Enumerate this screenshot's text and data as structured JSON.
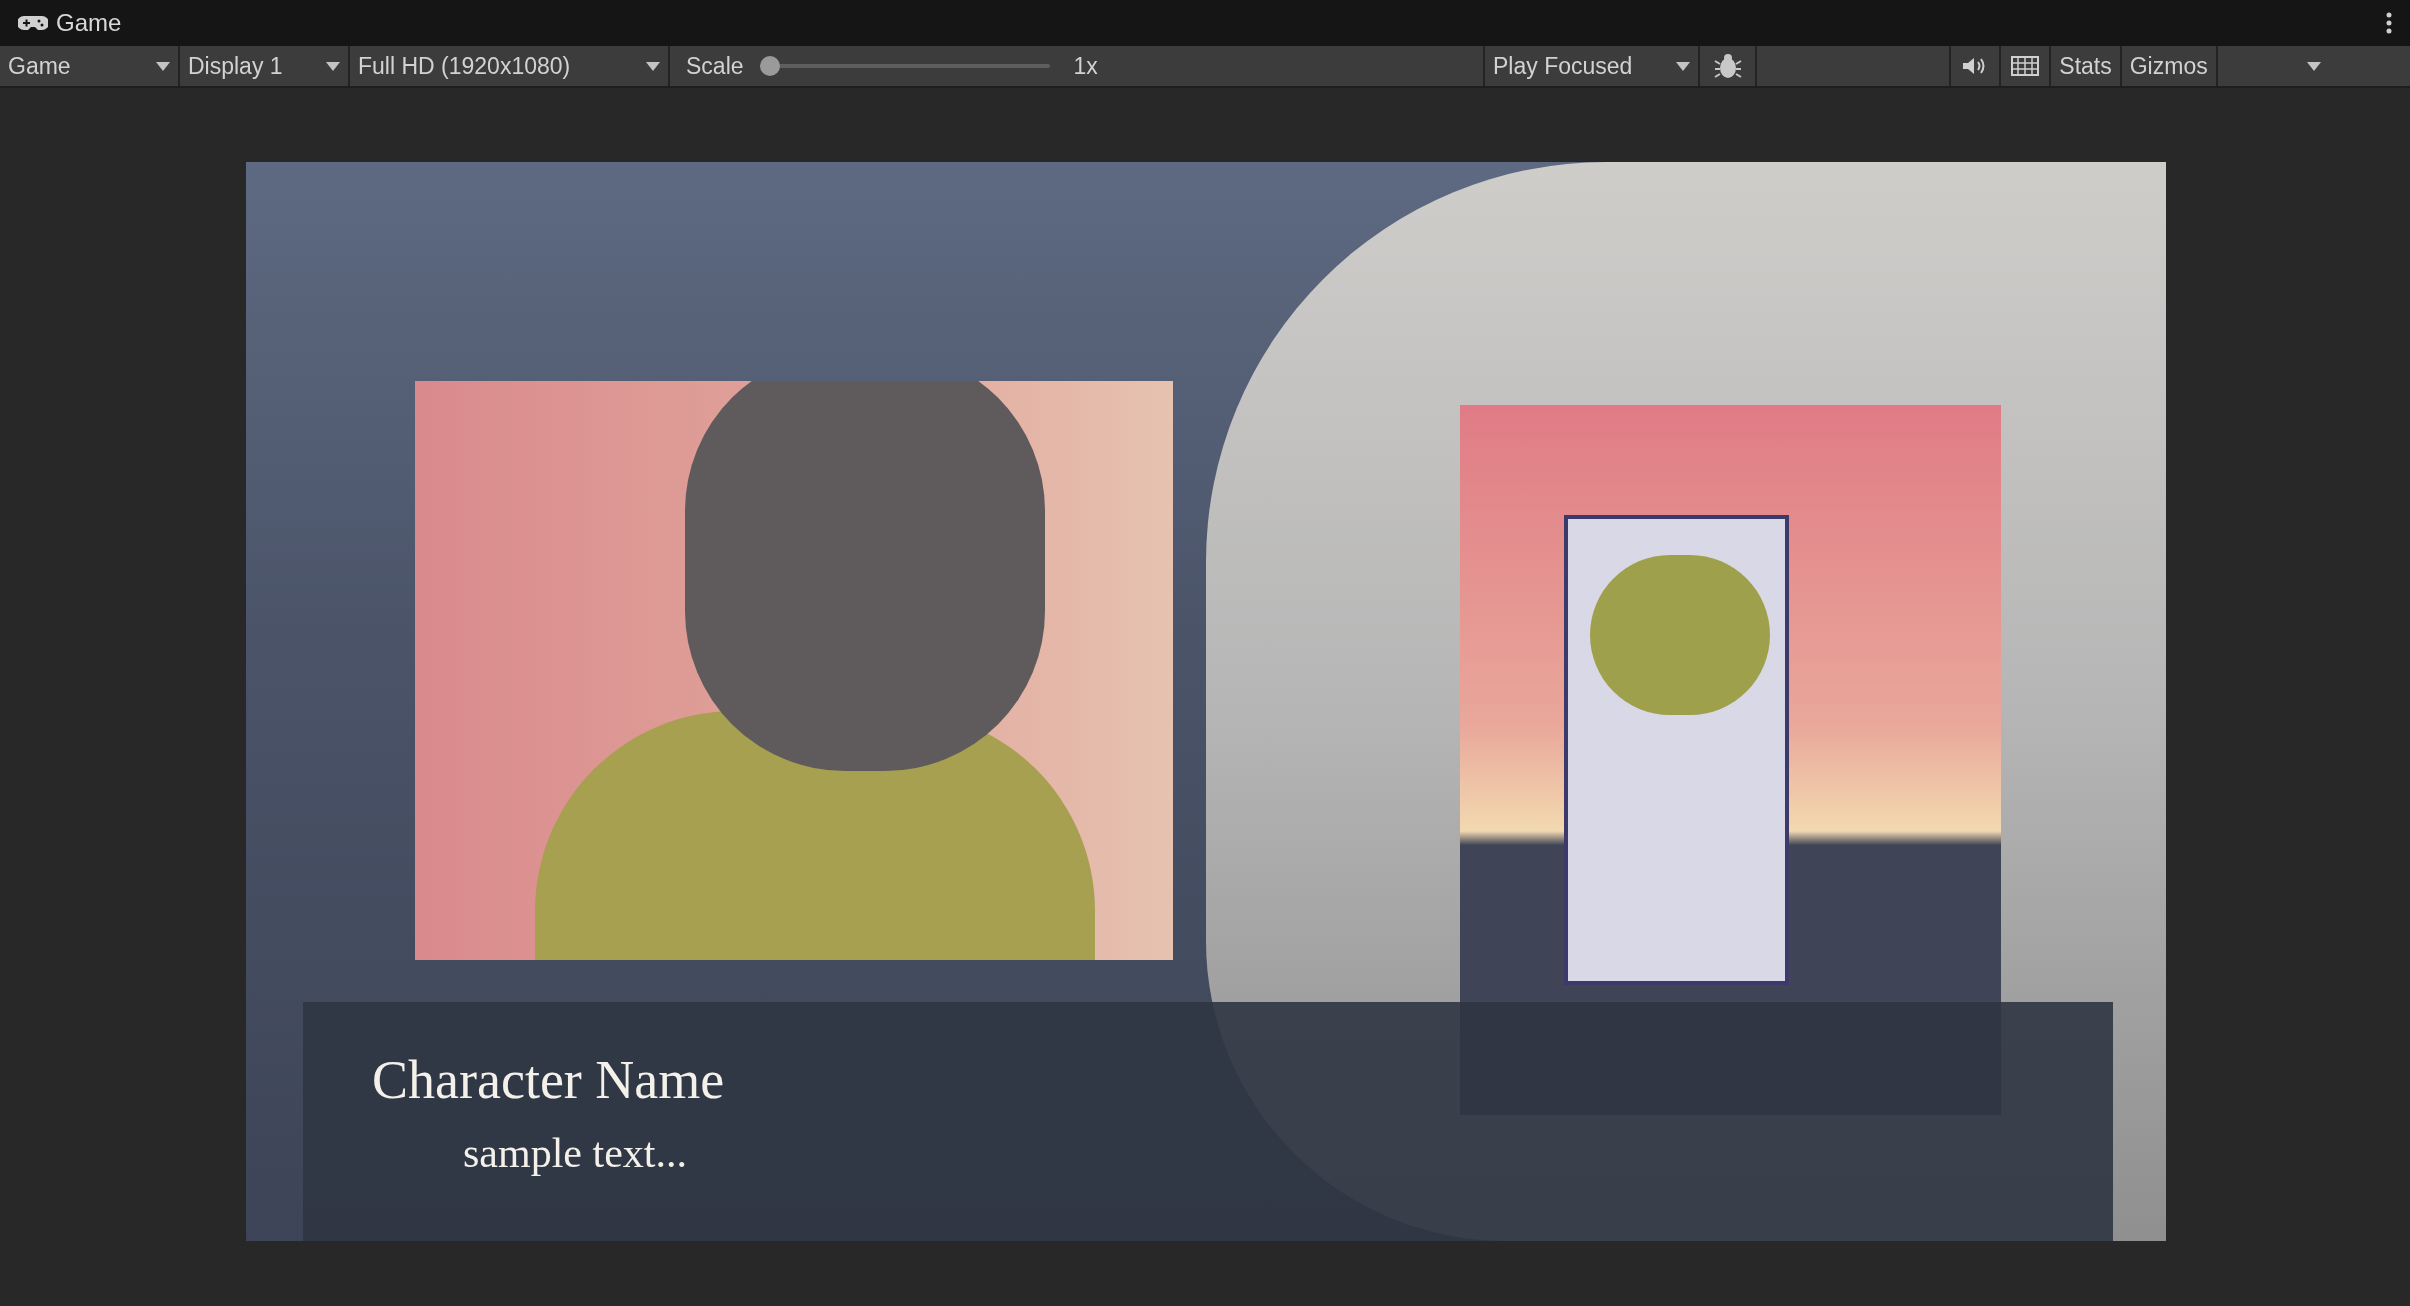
{
  "window": {
    "title": "Game"
  },
  "toolbar": {
    "view_dropdown": "Game",
    "display_dropdown": "Display 1",
    "resolution_dropdown": "Full HD (1920x1080)",
    "scale": {
      "label": "Scale",
      "level": 0,
      "reading": "1x"
    },
    "play_mode_dropdown": "Play Focused",
    "stats_button": "Stats",
    "gizmos_button": "Gizmos"
  },
  "game_view": {
    "dialogue": {
      "character_name": "Character Name",
      "text": "sample text..."
    }
  }
}
